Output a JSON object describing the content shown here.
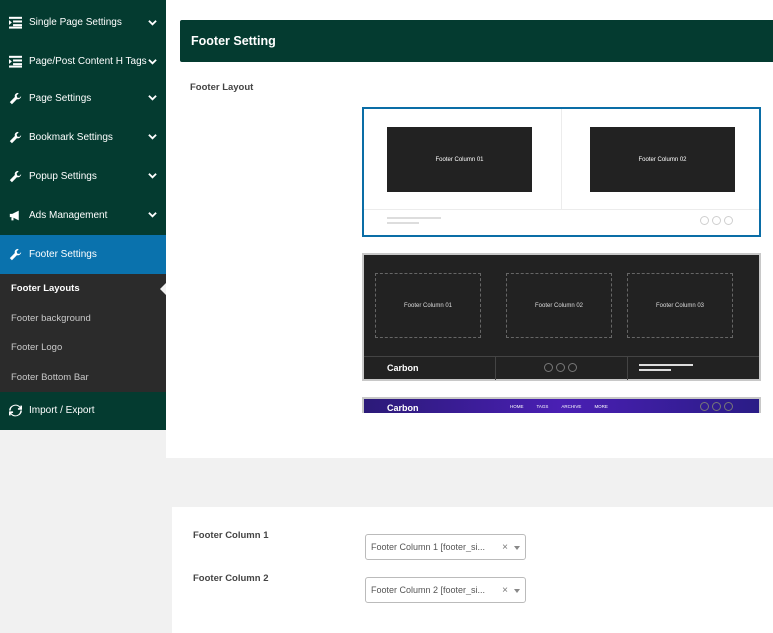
{
  "sidebar": {
    "items": [
      {
        "label": "Single Page Settings",
        "icon": "list-icon"
      },
      {
        "label": "Page/Post Content H Tags",
        "icon": "list-icon"
      },
      {
        "label": "Page Settings",
        "icon": "wrench-icon"
      },
      {
        "label": "Bookmark Settings",
        "icon": "wrench-icon"
      },
      {
        "label": "Popup Settings",
        "icon": "wrench-icon"
      },
      {
        "label": "Ads Management",
        "icon": "megaphone-icon"
      },
      {
        "label": "Footer Settings",
        "icon": "wrench-icon"
      }
    ],
    "submenu": [
      {
        "label": "Footer Layouts"
      },
      {
        "label": "Footer background"
      },
      {
        "label": "Footer Logo"
      },
      {
        "label": "Footer Bottom Bar"
      }
    ],
    "import_export": {
      "label": "Import / Export",
      "icon": "refresh-icon"
    }
  },
  "panel": {
    "title": "Footer Setting",
    "footer_layout_label": "Footer Layout",
    "layouts": [
      {
        "columns": [
          "Footer Column 01",
          "Footer Column 02"
        ]
      },
      {
        "columns": [
          "Footer Column 01",
          "Footer Column 02",
          "Footer Column 03"
        ],
        "brand": "Carbon"
      },
      {
        "brand": "Carbon",
        "menu": [
          "HOME",
          "TAGS",
          "ARCHIVE",
          "MORE"
        ]
      }
    ]
  },
  "form": {
    "fields": [
      {
        "label": "Footer Column 1",
        "value": "Footer Column 1 [footer_si..."
      },
      {
        "label": "Footer Column 2",
        "value": "Footer Column 2 [footer_si..."
      }
    ],
    "clear_glyph": "×"
  },
  "colors": {
    "sidebar_bg": "#043b30",
    "active_item": "#0a72ad",
    "submenu_bg": "#2b2b2b",
    "selected_border": "#0a6da6"
  }
}
